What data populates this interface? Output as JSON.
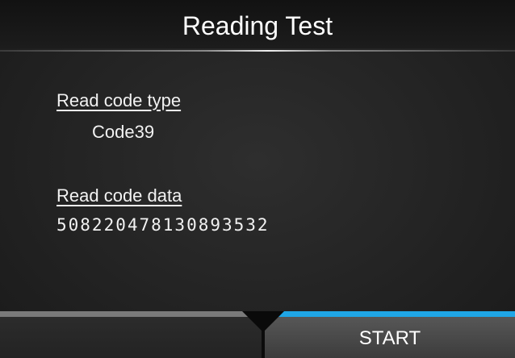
{
  "screen": {
    "title": "Reading Test"
  },
  "fields": {
    "code_type_label": "Read code type",
    "code_type_value": "Code39",
    "code_data_label": "Read code data",
    "code_data_value": "508220478130893532"
  },
  "softkeys": {
    "left_label": "",
    "right_label": "START"
  },
  "colors": {
    "accent": "#1fa6e6",
    "inactive_bar": "#7a7a7a",
    "background": "#222222",
    "text": "#f2f2f2"
  }
}
